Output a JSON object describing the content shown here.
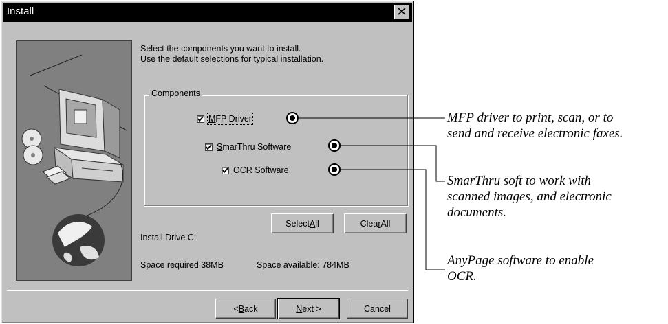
{
  "window": {
    "title": "Install",
    "close_icon": "close-icon"
  },
  "instructions": {
    "line1": "Select the components you want to install.",
    "line2": "Use the default selections for typical installation."
  },
  "components": {
    "group_label": "Components",
    "items": [
      {
        "label_pre": "",
        "label_accel": "M",
        "label_post": "FP Driver",
        "checked": true
      },
      {
        "label_pre": "",
        "label_accel": "S",
        "label_post": "marThru Software",
        "checked": true
      },
      {
        "label_pre": "",
        "label_accel": "O",
        "label_post": "CR Software",
        "checked": true
      }
    ]
  },
  "buttons": {
    "select_all": {
      "pre": "Select ",
      "accel": "A",
      "post": "ll"
    },
    "clear_all": {
      "pre": "Clea",
      "accel": "r",
      "post": " All"
    },
    "back": {
      "pre": "< ",
      "accel": "B",
      "post": "ack"
    },
    "next": {
      "pre": "",
      "accel": "N",
      "post": "ext >"
    },
    "cancel": {
      "label": "Cancel"
    }
  },
  "install_info": {
    "drive": "Install Drive C:",
    "space_required": "Space required 38MB",
    "space_available": "Space available: 784MB"
  },
  "annotations": {
    "mfp": {
      "line1": "MFP driver to print, scan, or to",
      "line2": "send and receive electronic faxes."
    },
    "smarthru": {
      "line1": "SmarThru soft to work with",
      "line2": "scanned images, and electronic",
      "line3": "documents."
    },
    "anypage": {
      "line1": "AnyPage software to enable",
      "line2": "OCR."
    }
  }
}
